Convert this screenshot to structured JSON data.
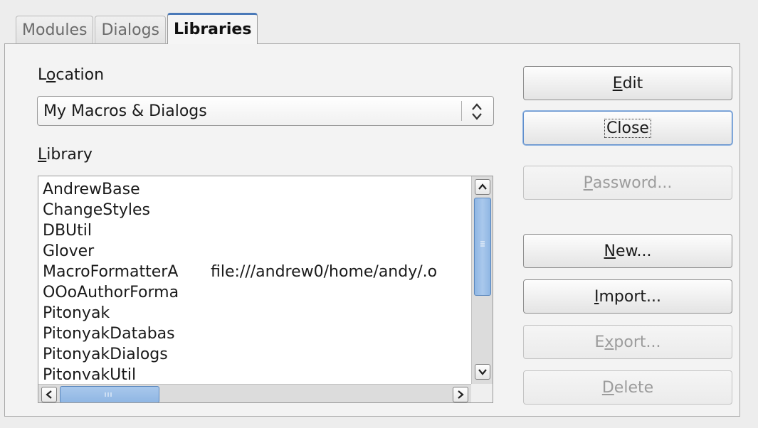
{
  "tabs": [
    {
      "label": "Modules",
      "active": false
    },
    {
      "label": "Dialogs",
      "active": false
    },
    {
      "label": "Libraries",
      "active": true
    }
  ],
  "location": {
    "label_pre": "L",
    "label_mn": "o",
    "label_post": "cation",
    "value": "My Macros & Dialogs"
  },
  "library": {
    "label_mn": "L",
    "label_post": "ibrary",
    "items": [
      {
        "name": "AndrewBase",
        "path": ""
      },
      {
        "name": "ChangeStyles",
        "path": ""
      },
      {
        "name": "DBUtil",
        "path": ""
      },
      {
        "name": "Glover",
        "path": ""
      },
      {
        "name": "MacroFormatterA",
        "path": "file:///andrew0/home/andy/.o"
      },
      {
        "name": "OOoAuthorForma",
        "path": ""
      },
      {
        "name": "Pitonyak",
        "path": ""
      },
      {
        "name": "PitonyakDatabas",
        "path": ""
      },
      {
        "name": "PitonyakDialogs",
        "path": ""
      },
      {
        "name": "PitonyakUtil",
        "path": ""
      }
    ]
  },
  "buttons": {
    "edit": {
      "mn": "E",
      "post": "dit"
    },
    "close": {
      "label": "Close"
    },
    "password": {
      "mn": "P",
      "post": "assword..."
    },
    "new": {
      "mn": "N",
      "post": "ew..."
    },
    "import": {
      "mn": "I",
      "post": "mport..."
    },
    "export": {
      "pre": "E",
      "mn": "x",
      "post": "port..."
    },
    "delete": {
      "mn": "D",
      "post": "elete"
    }
  },
  "icons": {
    "combo": "up-down-arrows-icon",
    "scroll_up": "chevron-up-icon",
    "scroll_down": "chevron-down-icon",
    "scroll_left": "chevron-left-icon",
    "scroll_right": "chevron-right-icon",
    "grip": "grip-icon"
  },
  "colors": {
    "accent": "#4a79b8",
    "scroll_thumb": "#a9c8ec",
    "disabled_text": "#9c9c9c"
  }
}
